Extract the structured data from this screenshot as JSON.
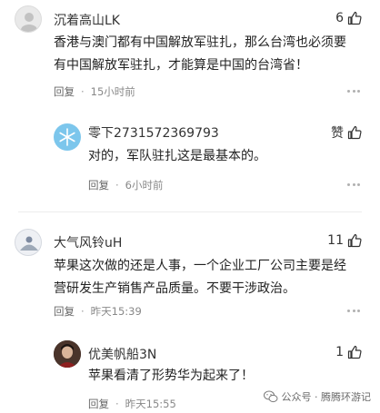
{
  "comments": [
    {
      "username": "沉着高山LK",
      "likes": "6",
      "text_lines": [
        "香港与澳门都有中国解放军驻扎，那么台湾也必须要",
        "有中国解放军驻扎，才能算是中国的台湾省！"
      ],
      "reply_label": "回复",
      "time": "15小时前"
    },
    {
      "username": "零下2731572369793",
      "likes": "赞",
      "text_lines": [
        "对的，军队驻扎这是最基本的。"
      ],
      "reply_label": "回复",
      "time": "6小时前"
    },
    {
      "username": "大气风铃uH",
      "likes": "11",
      "text_lines": [
        "苹果这次做的还是人事，一个企业工厂公司主要是经",
        "营研发生产销售产品质量。不要干涉政治。"
      ],
      "reply_label": "回复",
      "time": "昨天15:39"
    },
    {
      "username": "优美帆船3N",
      "likes": "1",
      "text_lines": [
        "苹果看清了形势华为起来了！"
      ],
      "reply_label": "回复",
      "time": "昨天15:55"
    }
  ],
  "watermark": {
    "text": "公众号 · 腾腾环游记",
    "icon": "wechat-icon"
  },
  "colors": {
    "text": "#333333",
    "meta": "#888888",
    "divider": "#ececec"
  }
}
